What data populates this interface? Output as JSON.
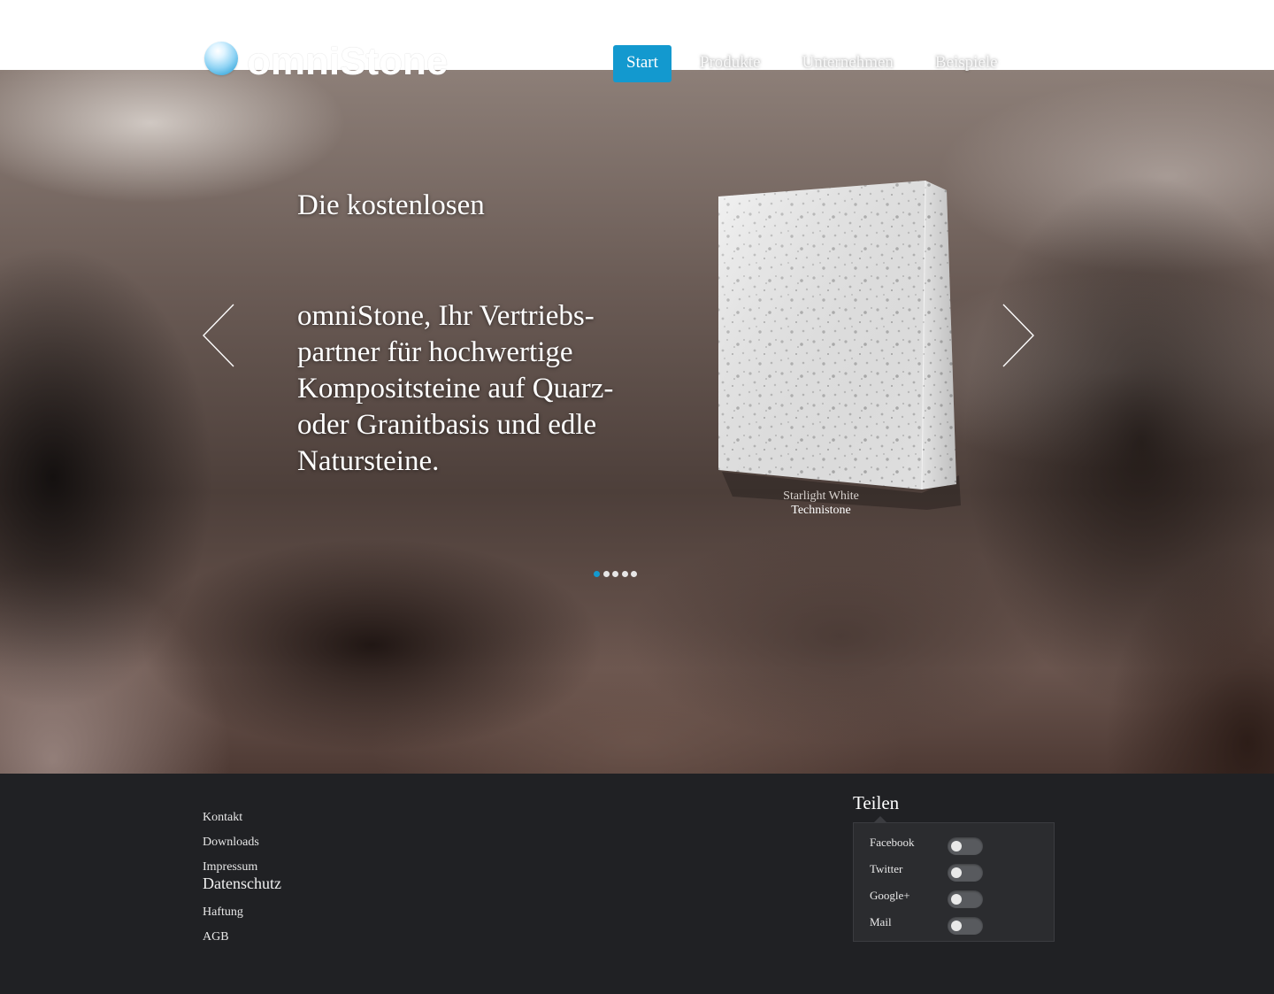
{
  "brand": {
    "name": "omniStone"
  },
  "nav": {
    "items": [
      {
        "label": "Start",
        "active": true
      },
      {
        "label": "Produkte",
        "active": false
      },
      {
        "label": "Unternehmen",
        "active": false
      },
      {
        "label": "Beispiele",
        "active": false
      }
    ]
  },
  "hero": {
    "heading": "Die kostenlosen",
    "text": "omniStone, Ihr Vertriebs-partner für hochwertige Kompositsteine auf Quarz- oder Granitbasis und edle Natursteine.",
    "prev_icon": "chevron-left-icon",
    "next_icon": "chevron-right-icon",
    "product": {
      "name": "Starlight White",
      "brand": "Technistone"
    },
    "slides": {
      "count": 5,
      "active_index": 0
    }
  },
  "footer": {
    "links": [
      "Kontakt",
      "Downloads",
      "Impressum",
      "Datenschutz",
      "Haftung",
      "AGB"
    ],
    "share": {
      "title": "Teilen",
      "items": [
        {
          "label": "Facebook",
          "enabled": false
        },
        {
          "label": "Twitter",
          "enabled": false
        },
        {
          "label": "Google+",
          "enabled": false
        },
        {
          "label": "Mail",
          "enabled": false
        }
      ]
    }
  },
  "colors": {
    "accent": "#1399cf",
    "footer_bg": "#202124",
    "toggle_off": "#585a5e"
  }
}
